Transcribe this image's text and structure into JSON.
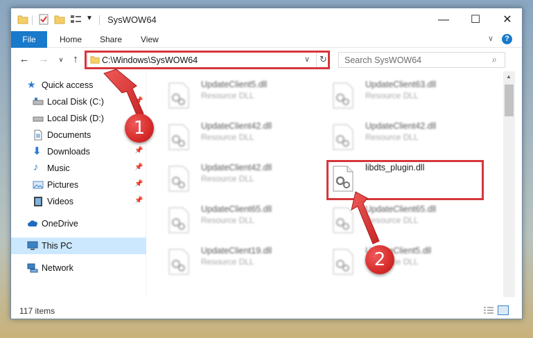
{
  "window": {
    "title": "SysWOW64",
    "controls": [
      "minimize-icon",
      "maximize-icon",
      "close-icon"
    ]
  },
  "ribbon": {
    "tabs": [
      "File",
      "Home",
      "Share",
      "View"
    ]
  },
  "address_bar": {
    "path": "C:\\Windows\\SysWOW64"
  },
  "search": {
    "placeholder": "Search SysWOW64"
  },
  "sidebar": {
    "items": [
      {
        "label": "Quick access",
        "icon": "star-icon",
        "pinned": false
      },
      {
        "label": "Local Disk (C:)",
        "icon": "drive-icon",
        "pinned": true
      },
      {
        "label": "Local Disk (D:)",
        "icon": "drive-icon",
        "pinned": false
      },
      {
        "label": "Documents",
        "icon": "document-icon",
        "pinned": true
      },
      {
        "label": "Downloads",
        "icon": "download-icon",
        "pinned": true
      },
      {
        "label": "Music",
        "icon": "music-icon",
        "pinned": true
      },
      {
        "label": "Pictures",
        "icon": "picture-icon",
        "pinned": true
      },
      {
        "label": "Videos",
        "icon": "video-icon",
        "pinned": true
      },
      {
        "label": "OneDrive",
        "icon": "cloud-icon",
        "pinned": false
      },
      {
        "label": "This PC",
        "icon": "computer-icon",
        "pinned": false,
        "selected": true
      },
      {
        "label": "Network",
        "icon": "network-icon",
        "pinned": false
      }
    ]
  },
  "files": [
    {
      "name": "UpdateClient5.dll",
      "type": "Resource DLL"
    },
    {
      "name": "UpdateClient63.dll",
      "type": "Resource DLL"
    },
    {
      "name": "UpdateClient42.dll",
      "type": "Resource DLL"
    },
    {
      "name": "UpdateClient42.dll",
      "type": "Resource DLL"
    },
    {
      "name": "UpdateClient42.dll",
      "type": "Resource DLL"
    },
    {
      "name": "libdts_plugin.dll",
      "type": ""
    },
    {
      "name": "UpdateClient65.dll",
      "type": "Resource DLL"
    },
    {
      "name": "UpdateClient65.dll",
      "type": "Resource DLL"
    },
    {
      "name": "UpdateClient19.dll",
      "type": "Resource DLL"
    },
    {
      "name": "UpdateClient5.dll",
      "type": "Resource DLL"
    }
  ],
  "status": {
    "item_count": "117 items"
  },
  "annotations": {
    "step1": "1",
    "step2": "2",
    "highlight_color": "#d6353b"
  },
  "colors": {
    "accent": "#1979ca",
    "selection": "#cce8ff"
  }
}
